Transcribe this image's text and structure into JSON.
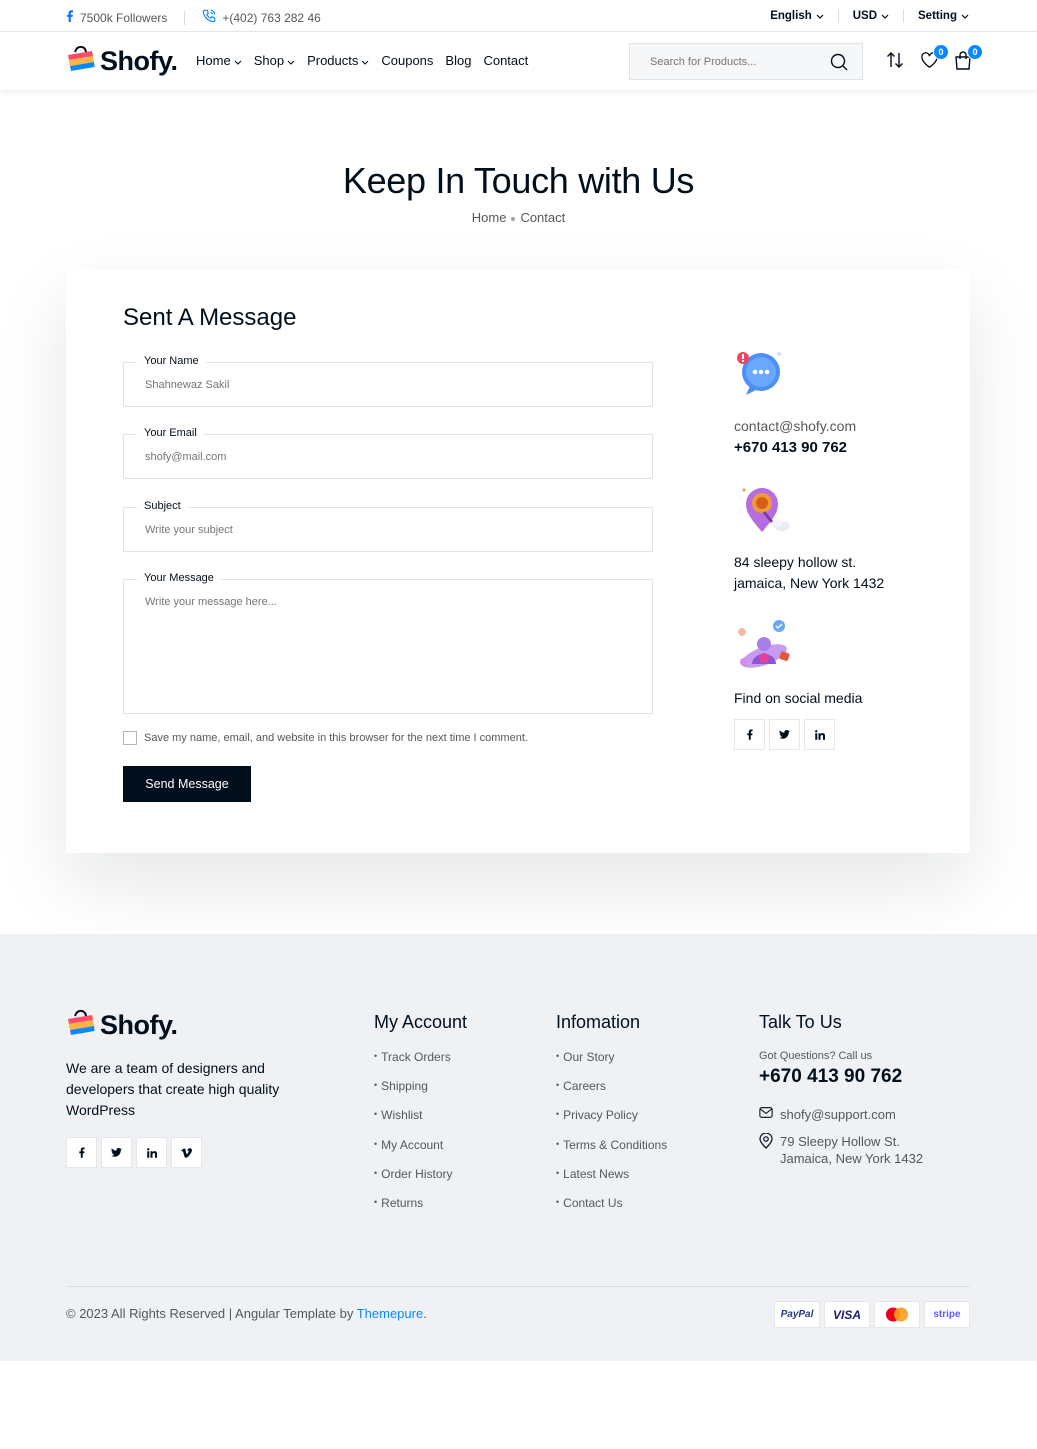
{
  "topbar": {
    "followers": "7500k Followers",
    "phone": "+(402) 763 282 46",
    "language": "English",
    "currency": "USD",
    "setting": "Setting"
  },
  "header": {
    "logo_text": "Shofy.",
    "nav": [
      {
        "label": "Home",
        "dropdown": true
      },
      {
        "label": "Shop",
        "dropdown": true
      },
      {
        "label": "Products",
        "dropdown": true
      },
      {
        "label": "Coupons",
        "dropdown": false
      },
      {
        "label": "Blog",
        "dropdown": false
      },
      {
        "label": "Contact",
        "dropdown": false
      }
    ],
    "search_placeholder": "Search for Products...",
    "wishlist_count": "0",
    "cart_count": "0"
  },
  "page": {
    "title": "Keep In Touch with Us",
    "breadcrumb": [
      "Home",
      "Contact"
    ]
  },
  "form": {
    "title": "Sent A Message",
    "name_label": "Your Name",
    "name_placeholder": "Shahnewaz Sakil",
    "email_label": "Your Email",
    "email_placeholder": "shofy@mail.com",
    "subject_label": "Subject",
    "subject_placeholder": "Write your subject",
    "message_label": "Your Message",
    "message_placeholder": "Write your message here...",
    "remember_label": "Save my name, email, and website in this browser for the next time I comment.",
    "submit_label": "Send Message"
  },
  "contact_info": {
    "email": "contact@shofy.com",
    "phone": "+670 413 90 762",
    "address_line1": "84 sleepy hollow st.",
    "address_line2": "jamaica, New York 1432",
    "social_label": "Find on social media"
  },
  "footer": {
    "logo_text": "Shofy.",
    "about": "We are a team of designers and developers that create high quality WordPress",
    "my_account": {
      "title": "My Account",
      "links": [
        "Track Orders",
        "Shipping",
        "Wishlist",
        "My Account",
        "Order History",
        "Returns"
      ]
    },
    "information": {
      "title": "Infomation",
      "links": [
        "Our Story",
        "Careers",
        "Privacy Policy",
        "Terms & Conditions",
        "Latest News",
        "Contact Us"
      ]
    },
    "talk": {
      "title": "Talk To Us",
      "question": "Got Questions? Call us",
      "phone": "+670 413 90 762",
      "email": "shofy@support.com",
      "address_line1": "79 Sleepy Hollow St.",
      "address_line2": "Jamaica, New York 1432"
    },
    "copyright": "© 2023 All Rights Reserved | Angular Template by",
    "copyright_brand": "Themepure",
    "payments": [
      "PayPal",
      "VISA",
      "mastercard",
      "stripe"
    ]
  },
  "colors": {
    "dark": "#010f1c",
    "accent": "#0989ff",
    "muted": "#55585b",
    "footer_bg": "#eff1f5"
  }
}
